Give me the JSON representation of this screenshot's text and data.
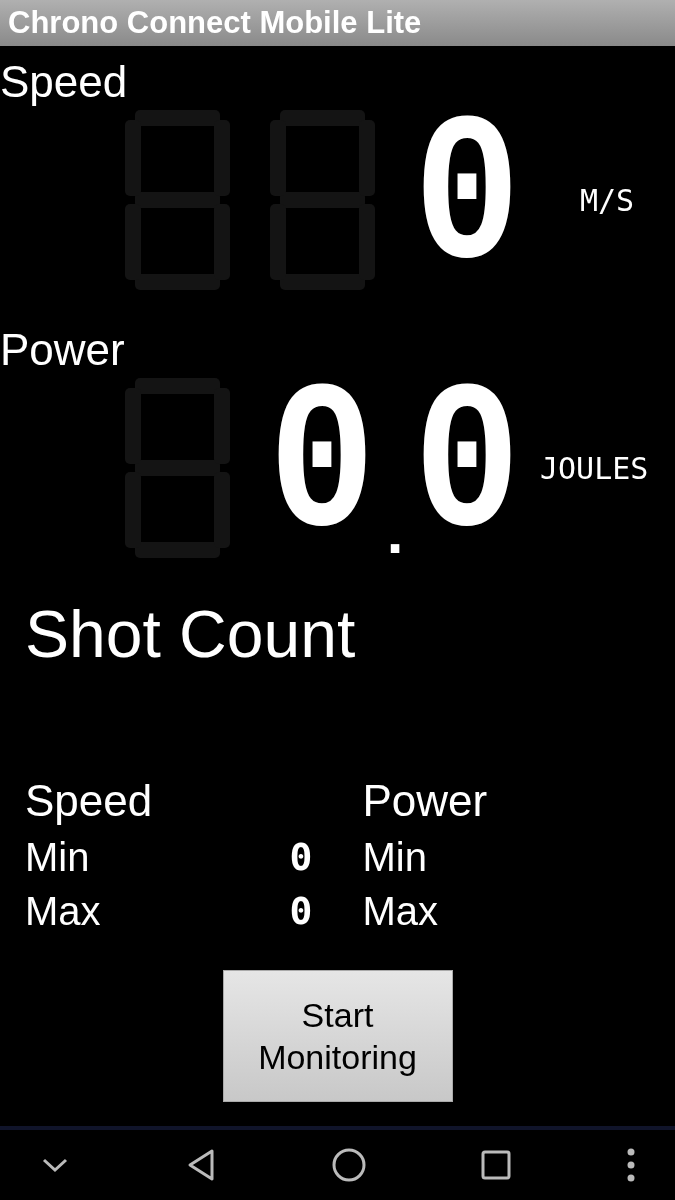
{
  "title_bar": {
    "title": "Chrono Connect Mobile Lite"
  },
  "readouts": [
    {
      "label": "Speed",
      "value": "0",
      "unit": "M/S"
    },
    {
      "label": "Power",
      "value": "0.0",
      "unit": "JOULES"
    }
  ],
  "shot_count": {
    "label": "Shot Count"
  },
  "stats": [
    {
      "heading": "Speed",
      "rows": [
        {
          "label": "Min",
          "value": "0"
        },
        {
          "label": "Max",
          "value": "0"
        }
      ]
    },
    {
      "heading": "Power",
      "rows": [
        {
          "label": "Min"
        },
        {
          "label": "Max"
        }
      ]
    }
  ],
  "button": {
    "label": "Start Monitoring"
  }
}
